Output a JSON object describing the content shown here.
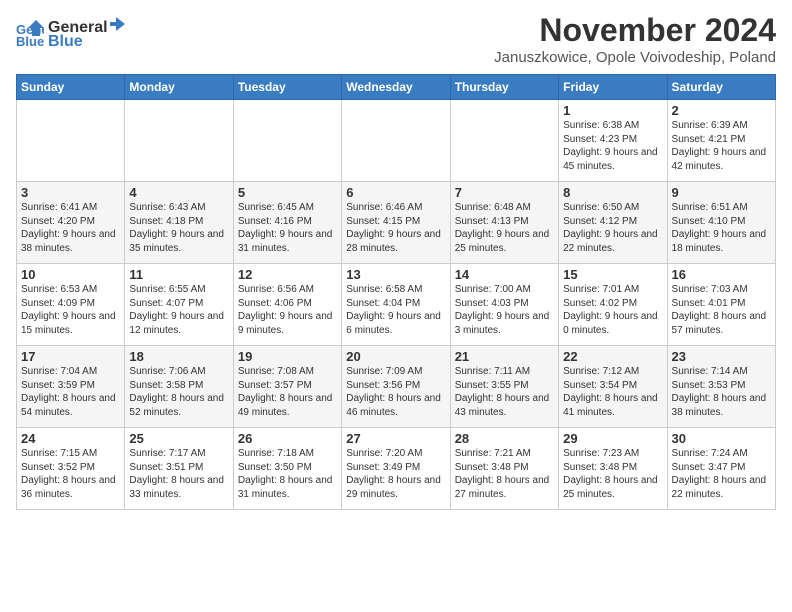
{
  "logo": {
    "line1": "General",
    "line2": "Blue"
  },
  "title": "November 2024",
  "location": "Januszkowice, Opole Voivodeship, Poland",
  "weekdays": [
    "Sunday",
    "Monday",
    "Tuesday",
    "Wednesday",
    "Thursday",
    "Friday",
    "Saturday"
  ],
  "weeks": [
    [
      {
        "day": "",
        "info": ""
      },
      {
        "day": "",
        "info": ""
      },
      {
        "day": "",
        "info": ""
      },
      {
        "day": "",
        "info": ""
      },
      {
        "day": "",
        "info": ""
      },
      {
        "day": "1",
        "info": "Sunrise: 6:38 AM\nSunset: 4:23 PM\nDaylight: 9 hours\nand 45 minutes."
      },
      {
        "day": "2",
        "info": "Sunrise: 6:39 AM\nSunset: 4:21 PM\nDaylight: 9 hours\nand 42 minutes."
      }
    ],
    [
      {
        "day": "3",
        "info": "Sunrise: 6:41 AM\nSunset: 4:20 PM\nDaylight: 9 hours\nand 38 minutes."
      },
      {
        "day": "4",
        "info": "Sunrise: 6:43 AM\nSunset: 4:18 PM\nDaylight: 9 hours\nand 35 minutes."
      },
      {
        "day": "5",
        "info": "Sunrise: 6:45 AM\nSunset: 4:16 PM\nDaylight: 9 hours\nand 31 minutes."
      },
      {
        "day": "6",
        "info": "Sunrise: 6:46 AM\nSunset: 4:15 PM\nDaylight: 9 hours\nand 28 minutes."
      },
      {
        "day": "7",
        "info": "Sunrise: 6:48 AM\nSunset: 4:13 PM\nDaylight: 9 hours\nand 25 minutes."
      },
      {
        "day": "8",
        "info": "Sunrise: 6:50 AM\nSunset: 4:12 PM\nDaylight: 9 hours\nand 22 minutes."
      },
      {
        "day": "9",
        "info": "Sunrise: 6:51 AM\nSunset: 4:10 PM\nDaylight: 9 hours\nand 18 minutes."
      }
    ],
    [
      {
        "day": "10",
        "info": "Sunrise: 6:53 AM\nSunset: 4:09 PM\nDaylight: 9 hours\nand 15 minutes."
      },
      {
        "day": "11",
        "info": "Sunrise: 6:55 AM\nSunset: 4:07 PM\nDaylight: 9 hours\nand 12 minutes."
      },
      {
        "day": "12",
        "info": "Sunrise: 6:56 AM\nSunset: 4:06 PM\nDaylight: 9 hours\nand 9 minutes."
      },
      {
        "day": "13",
        "info": "Sunrise: 6:58 AM\nSunset: 4:04 PM\nDaylight: 9 hours\nand 6 minutes."
      },
      {
        "day": "14",
        "info": "Sunrise: 7:00 AM\nSunset: 4:03 PM\nDaylight: 9 hours\nand 3 minutes."
      },
      {
        "day": "15",
        "info": "Sunrise: 7:01 AM\nSunset: 4:02 PM\nDaylight: 9 hours\nand 0 minutes."
      },
      {
        "day": "16",
        "info": "Sunrise: 7:03 AM\nSunset: 4:01 PM\nDaylight: 8 hours\nand 57 minutes."
      }
    ],
    [
      {
        "day": "17",
        "info": "Sunrise: 7:04 AM\nSunset: 3:59 PM\nDaylight: 8 hours\nand 54 minutes."
      },
      {
        "day": "18",
        "info": "Sunrise: 7:06 AM\nSunset: 3:58 PM\nDaylight: 8 hours\nand 52 minutes."
      },
      {
        "day": "19",
        "info": "Sunrise: 7:08 AM\nSunset: 3:57 PM\nDaylight: 8 hours\nand 49 minutes."
      },
      {
        "day": "20",
        "info": "Sunrise: 7:09 AM\nSunset: 3:56 PM\nDaylight: 8 hours\nand 46 minutes."
      },
      {
        "day": "21",
        "info": "Sunrise: 7:11 AM\nSunset: 3:55 PM\nDaylight: 8 hours\nand 43 minutes."
      },
      {
        "day": "22",
        "info": "Sunrise: 7:12 AM\nSunset: 3:54 PM\nDaylight: 8 hours\nand 41 minutes."
      },
      {
        "day": "23",
        "info": "Sunrise: 7:14 AM\nSunset: 3:53 PM\nDaylight: 8 hours\nand 38 minutes."
      }
    ],
    [
      {
        "day": "24",
        "info": "Sunrise: 7:15 AM\nSunset: 3:52 PM\nDaylight: 8 hours\nand 36 minutes."
      },
      {
        "day": "25",
        "info": "Sunrise: 7:17 AM\nSunset: 3:51 PM\nDaylight: 8 hours\nand 33 minutes."
      },
      {
        "day": "26",
        "info": "Sunrise: 7:18 AM\nSunset: 3:50 PM\nDaylight: 8 hours\nand 31 minutes."
      },
      {
        "day": "27",
        "info": "Sunrise: 7:20 AM\nSunset: 3:49 PM\nDaylight: 8 hours\nand 29 minutes."
      },
      {
        "day": "28",
        "info": "Sunrise: 7:21 AM\nSunset: 3:48 PM\nDaylight: 8 hours\nand 27 minutes."
      },
      {
        "day": "29",
        "info": "Sunrise: 7:23 AM\nSunset: 3:48 PM\nDaylight: 8 hours\nand 25 minutes."
      },
      {
        "day": "30",
        "info": "Sunrise: 7:24 AM\nSunset: 3:47 PM\nDaylight: 8 hours\nand 22 minutes."
      }
    ]
  ]
}
